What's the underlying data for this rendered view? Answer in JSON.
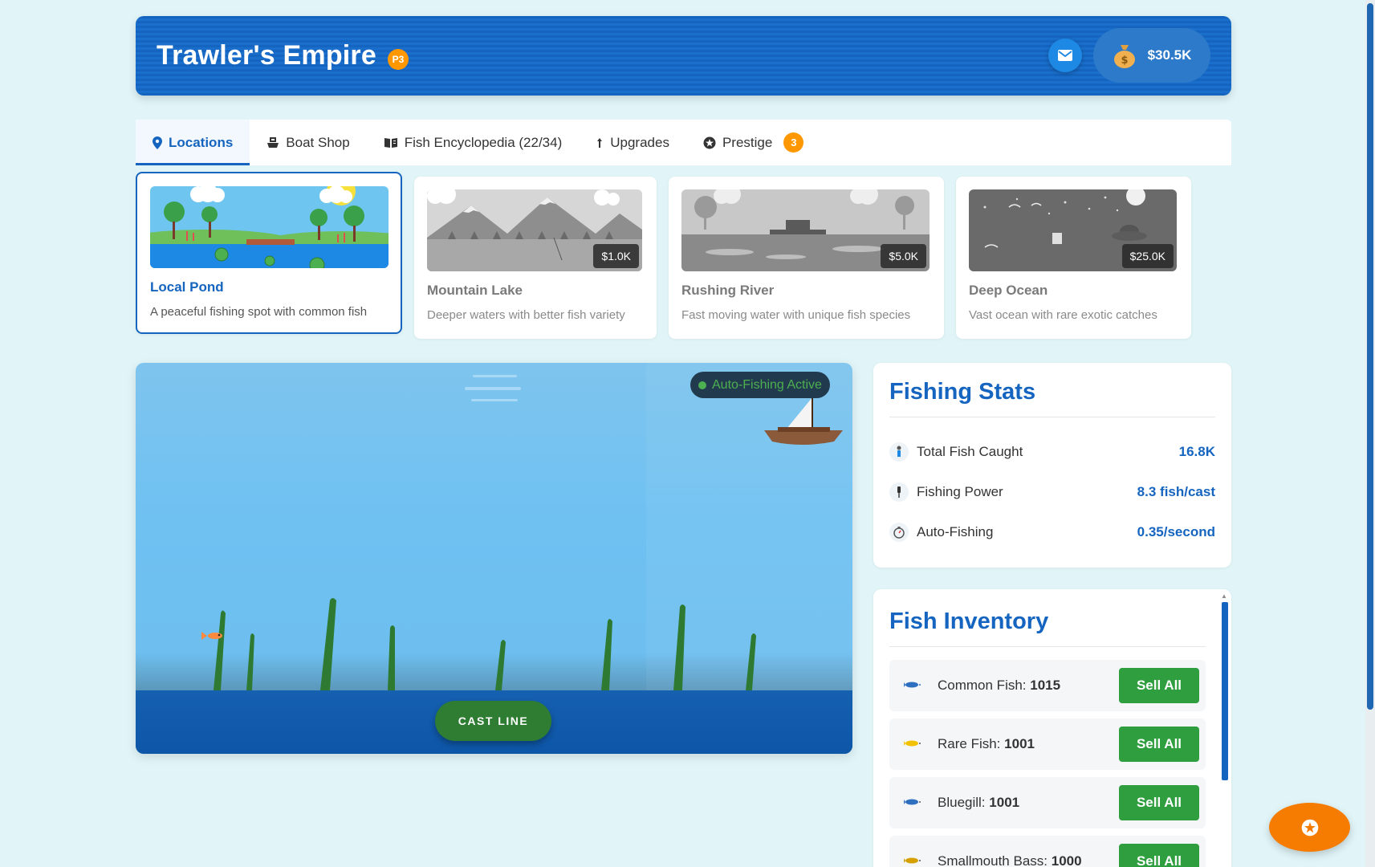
{
  "header": {
    "title": "Trawler's Empire",
    "prestige_badge": "P3",
    "money": "$30.5K"
  },
  "tabs": [
    {
      "label": "Locations",
      "icon": "map-pin-icon",
      "active": true
    },
    {
      "label": "Boat Shop",
      "icon": "ship-icon"
    },
    {
      "label": "Fish Encyclopedia (22/34)",
      "icon": "book-icon"
    },
    {
      "label": "Upgrades",
      "icon": "arrow-up-icon"
    },
    {
      "label": "Prestige",
      "icon": "star-icon",
      "badge": "3"
    }
  ],
  "locations": [
    {
      "name": "Local Pond",
      "description": "A peaceful fishing spot with common fish",
      "price": "",
      "active": true
    },
    {
      "name": "Mountain Lake",
      "description": "Deeper waters with better fish variety",
      "price": "$1.0K"
    },
    {
      "name": "Rushing River",
      "description": "Fast moving water with unique fish species",
      "price": "$5.0K"
    },
    {
      "name": "Deep Ocean",
      "description": "Vast ocean with rare exotic catches",
      "price": "$25.0K"
    }
  ],
  "scene": {
    "auto_fishing_label": "Auto-Fishing Active",
    "cast_button": "CAST LINE"
  },
  "stats": {
    "title": "Fishing Stats",
    "rows": [
      {
        "label": "Total Fish Caught",
        "value": "16.8K",
        "icon": "fisher-icon"
      },
      {
        "label": "Fishing Power",
        "value": "8.3 fish/cast",
        "icon": "fishing-rod-icon"
      },
      {
        "label": "Auto-Fishing",
        "value": "0.35/second",
        "icon": "stopwatch-icon"
      }
    ]
  },
  "inventory": {
    "title": "Fish Inventory",
    "sell_label": "Sell All",
    "items": [
      {
        "name": "Common Fish:",
        "count": "1015",
        "color": "#2f6fc0"
      },
      {
        "name": "Rare Fish:",
        "count": "1001",
        "color": "#f2c200"
      },
      {
        "name": "Bluegill:",
        "count": "1001",
        "color": "#2f6fc0"
      },
      {
        "name": "Smallmouth Bass:",
        "count": "1000",
        "color": "#d6a000"
      }
    ]
  },
  "colors": {
    "primary": "#1565c0",
    "accent": "#ff9800",
    "success": "#2e9e3e"
  }
}
